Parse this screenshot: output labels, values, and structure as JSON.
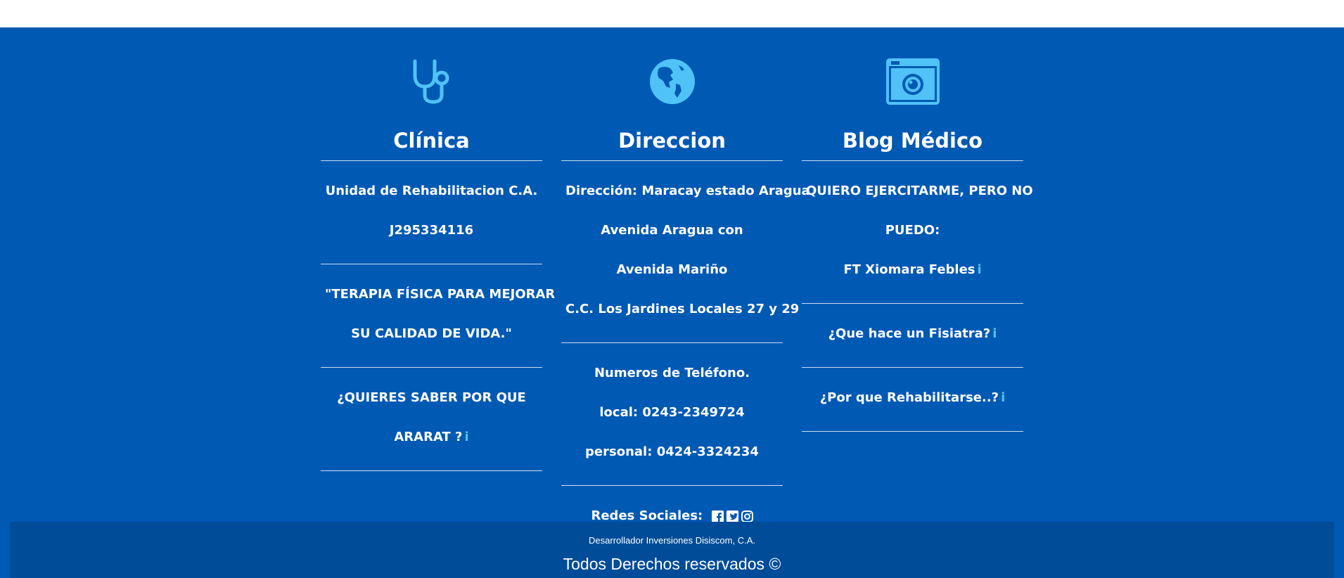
{
  "colors": {
    "background": "#0059b3",
    "bottom_bar": "#004c99",
    "icon": "#4fc3f7",
    "text": "#ffffff"
  },
  "columns": [
    {
      "icon": "stethoscope-icon",
      "title": "Clínica",
      "blocks": [
        {
          "lines": [
            "Unidad de Rehabilitacion C.A.",
            "J295334116"
          ]
        },
        {
          "lines": [
            "\"TERAPIA FÍSICA PARA MEJORAR",
            "SU CALIDAD DE VIDA.\""
          ]
        },
        {
          "lines": [
            "¿QUIERES SABER POR QUE",
            "ARARAT ?"
          ],
          "info": "i"
        }
      ]
    },
    {
      "icon": "globe-icon",
      "title": "Direccion",
      "blocks": [
        {
          "lines": [
            "Dirección: Maracay estado Aragua",
            "Avenida Aragua con",
            "Avenida Mariño",
            "C.C. Los Jardines Locales 27 y 29"
          ]
        },
        {
          "lines": [
            "Numeros de Teléfono.",
            "local: 0243-2349724",
            "personal: 0424-3324234"
          ]
        },
        {
          "lines": [
            "Redes Sociales:"
          ],
          "social": [
            "facebook-icon",
            "twitter-icon",
            "instagram-icon"
          ]
        }
      ]
    },
    {
      "icon": "camera-icon",
      "title": "Blog Médico",
      "blocks": [
        {
          "lines": [
            "QUIERO EJERCITARME, PERO NO",
            "PUEDO:",
            "FT Xiomara Febles"
          ],
          "info": "i"
        },
        {
          "lines": [
            "¿Que hace un Fisiatra?"
          ],
          "info": "i"
        },
        {
          "lines": [
            "¿Por que Rehabilitarse..?"
          ],
          "info": "i"
        }
      ]
    }
  ],
  "bottom": {
    "developer": "Desarrollador Inversiones Disiscom, C.A.",
    "rights": "Todos Derechos reservados ©"
  }
}
